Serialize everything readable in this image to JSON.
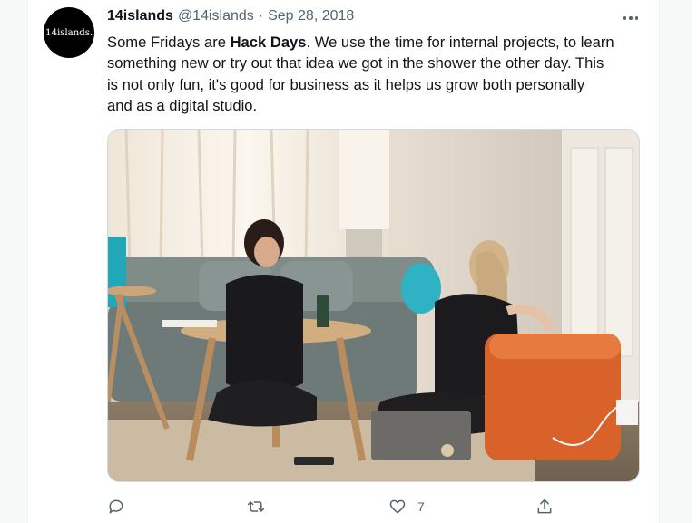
{
  "tweet": {
    "author_name": "14islands",
    "author_handle": "@14islands",
    "separator": "·",
    "date": "Sep 28, 2018",
    "avatar_text": "14islands.",
    "text_lines": [
      {
        "pre": "Some Fridays are ",
        "bold": "Hack Days",
        "post": ". We use the time for internal projects, to learn"
      },
      {
        "pre": "something new or try out that idea we got in the shower the other day. This",
        "bold": "",
        "post": ""
      },
      {
        "pre": "is not only fun, it's good for business as it helps us grow both personally",
        "bold": "",
        "post": ""
      },
      {
        "pre": "and as a digital studio.",
        "bold": "",
        "post": ""
      }
    ],
    "photo_alt": "Two people working on laptops in a living room",
    "actions": {
      "reply_icon": "reply-icon",
      "retweet_icon": "retweet-icon",
      "like_icon": "heart-icon",
      "like_count": "7",
      "share_icon": "share-icon"
    }
  },
  "colors": {
    "text_primary": "#0f1419",
    "text_secondary": "#536471",
    "border": "#cfd9de"
  }
}
